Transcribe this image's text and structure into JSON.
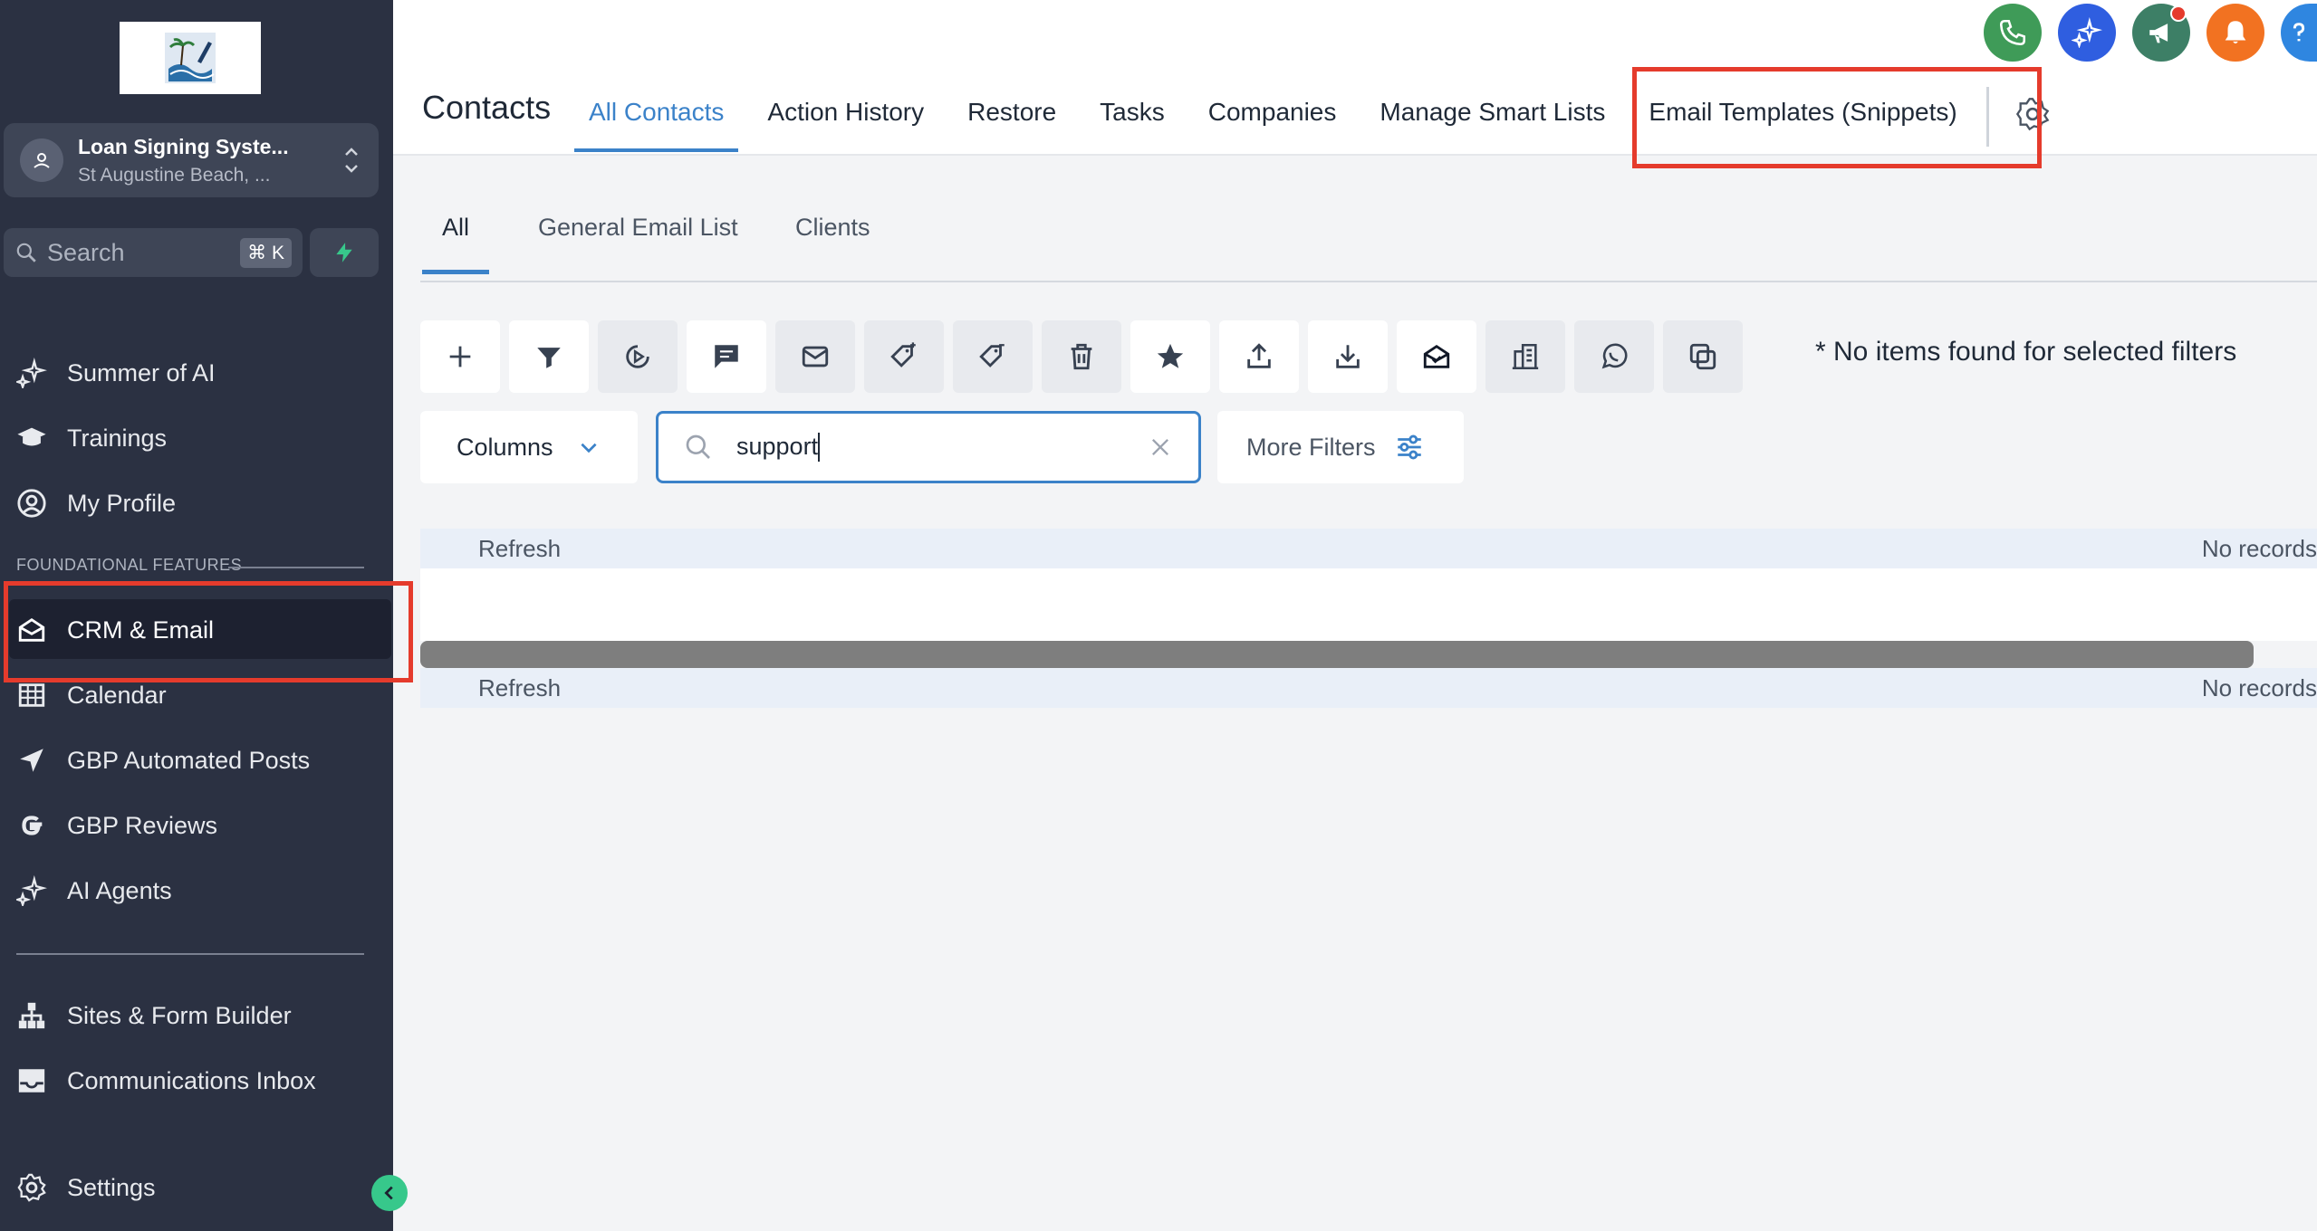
{
  "account": {
    "name": "Loan Signing Syste...",
    "location": "St Augustine Beach, ..."
  },
  "search": {
    "label": "Search",
    "shortcut": "⌘ K"
  },
  "sidebar": {
    "items_top": [
      {
        "label": "Summer of AI",
        "icon": "sparkle-icon"
      },
      {
        "label": "Trainings",
        "icon": "graduation-cap-icon"
      },
      {
        "label": "My Profile",
        "icon": "user-circle-icon"
      }
    ],
    "section_label": "FOUNDATIONAL FEATURES",
    "items_main": [
      {
        "label": "CRM & Email",
        "icon": "mail-open-icon",
        "active": true
      },
      {
        "label": "Calendar",
        "icon": "calendar-grid-icon"
      },
      {
        "label": "GBP Automated Posts",
        "icon": "send-arrow-icon"
      },
      {
        "label": "GBP Reviews",
        "icon": "google-g-icon"
      },
      {
        "label": "AI Agents",
        "icon": "sparkle-icon"
      }
    ],
    "items_bottom": [
      {
        "label": "Sites & Form Builder",
        "icon": "sitemap-icon"
      },
      {
        "label": "Communications Inbox",
        "icon": "inbox-icon"
      }
    ],
    "settings": "Settings"
  },
  "header": {
    "title": "Contacts",
    "tabs": [
      "All Contacts",
      "Action History",
      "Restore",
      "Tasks",
      "Companies",
      "Manage Smart Lists",
      "Email Templates (Snippets)"
    ]
  },
  "subtabs": [
    "All",
    "General Email List",
    "Clients"
  ],
  "status": {
    "no_items": "* No items found for selected filters"
  },
  "filters": {
    "columns_label": "Columns",
    "search_value": "support",
    "more_filters_label": "More Filters"
  },
  "table": {
    "refresh": "Refresh",
    "no_records": "No records"
  },
  "colors": {
    "accent": "#3b82c9",
    "sidebar": "#2b3142",
    "highlight": "#e53b2c"
  }
}
